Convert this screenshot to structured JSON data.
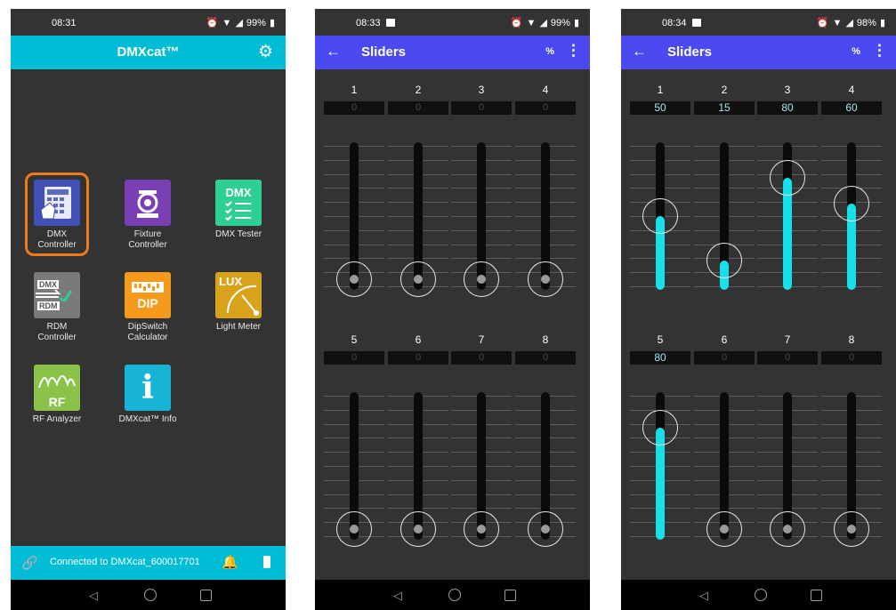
{
  "screen1": {
    "status_time": "08:31",
    "status_battery": "99%",
    "title": "DMXcat™",
    "tiles": [
      {
        "label1": "DMX",
        "label2": "Controller",
        "icon": "dmx-controller-icon",
        "color": "#3f51b5"
      },
      {
        "label1": "Fixture",
        "label2": "Controller",
        "icon": "fixture-controller-icon",
        "color": "#7b3fb5"
      },
      {
        "label1": "DMX Tester",
        "label2": "",
        "icon": "dmx-tester-icon",
        "color": "#2ecf93",
        "glyph": "DMX"
      },
      {
        "label1": "RDM",
        "label2": "Controller",
        "icon": "rdm-controller-icon",
        "color": "#7a7a7a",
        "glyph": "DMX\nRDM"
      },
      {
        "label1": "DipSwitch",
        "label2": "Calculator",
        "icon": "dipswitch-icon",
        "color": "#f59a1b",
        "glyph": "DIP"
      },
      {
        "label1": "Light Meter",
        "label2": "",
        "icon": "light-meter-icon",
        "color": "#d9a21b",
        "glyph": "LUX"
      },
      {
        "label1": "RF Analyzer",
        "label2": "",
        "icon": "rf-analyzer-icon",
        "color": "#8bc34a",
        "glyph": "RF"
      },
      {
        "label1": "DMXcat™ Info",
        "label2": "",
        "icon": "info-icon",
        "color": "#17b4d6",
        "glyph": "i"
      }
    ],
    "connection_text": "Connected to  DMXcat_600017701"
  },
  "screen2": {
    "status_time": "08:33",
    "status_battery": "99%",
    "title": "Sliders",
    "pct_label": "%",
    "channels": [
      {
        "label": "1",
        "value": "0"
      },
      {
        "label": "2",
        "value": "0"
      },
      {
        "label": "3",
        "value": "0"
      },
      {
        "label": "4",
        "value": "0"
      },
      {
        "label": "5",
        "value": "0"
      },
      {
        "label": "6",
        "value": "0"
      },
      {
        "label": "7",
        "value": "0"
      },
      {
        "label": "8",
        "value": "0"
      }
    ]
  },
  "screen3": {
    "status_time": "08:34",
    "status_battery": "98%",
    "title": "Sliders",
    "pct_label": "%",
    "channels": [
      {
        "label": "1",
        "value": "50"
      },
      {
        "label": "2",
        "value": "15"
      },
      {
        "label": "3",
        "value": "80"
      },
      {
        "label": "4",
        "value": "60"
      },
      {
        "label": "5",
        "value": "80"
      },
      {
        "label": "6",
        "value": "0"
      },
      {
        "label": "7",
        "value": "0"
      },
      {
        "label": "8",
        "value": "0"
      }
    ]
  },
  "colors": {
    "teal": "#00bcd4",
    "blue_appbar": "#4a4af0",
    "slider_fill": "#17e0ea",
    "highlight_orange": "#ee7a1a"
  }
}
